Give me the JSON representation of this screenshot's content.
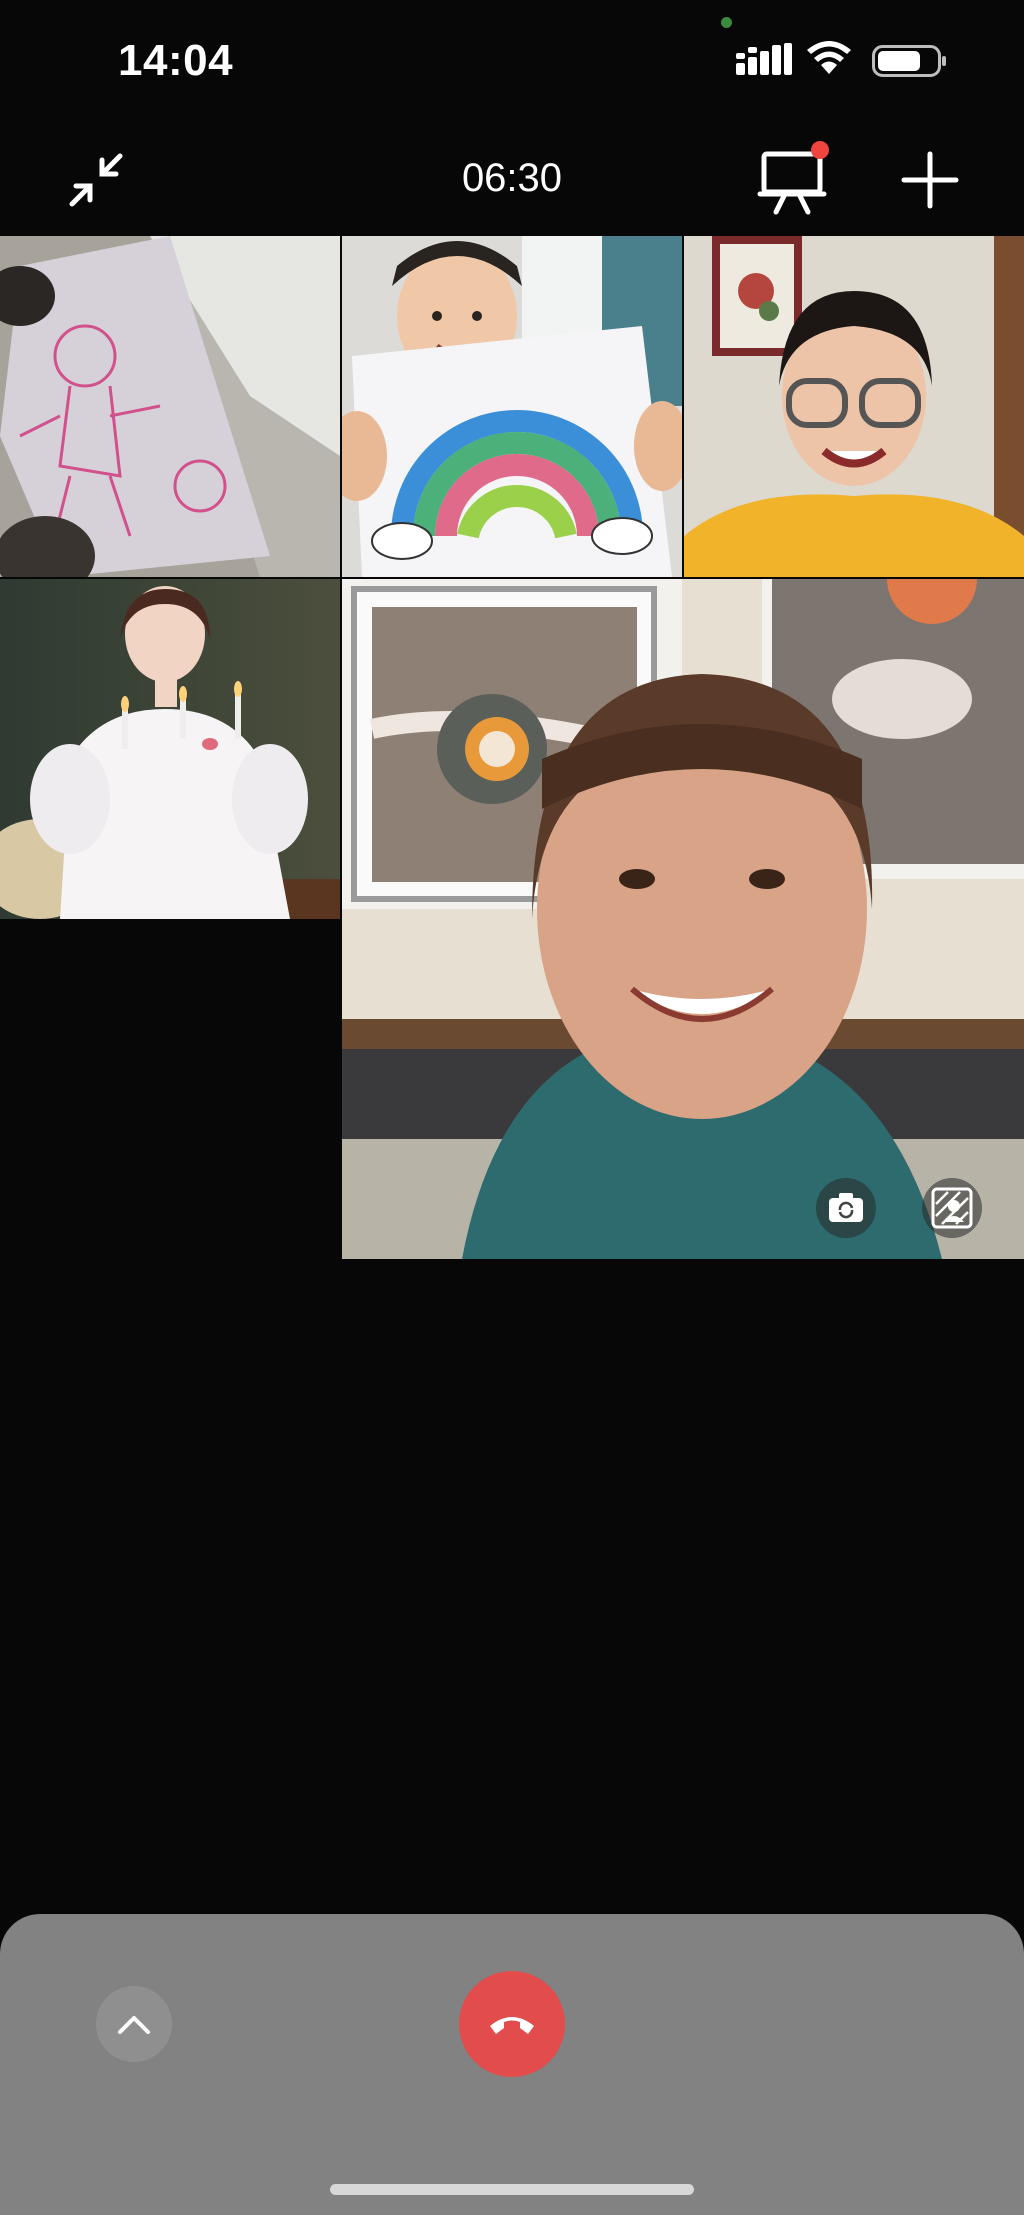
{
  "status_bar": {
    "time": "14:04",
    "icons": [
      "signal-icon",
      "wifi-icon",
      "battery-icon"
    ]
  },
  "call": {
    "duration": "06:30",
    "controls": [
      "minimize-icon",
      "screen-share-icon",
      "add-member-icon"
    ],
    "screen_share_badge_color": "#f0443e"
  },
  "tiles": [
    {
      "name": "participant-drawing-stickfigure"
    },
    {
      "name": "participant-boy-rainbow"
    },
    {
      "name": "participant-woman-glasses"
    },
    {
      "name": "participant-bride-candles"
    },
    {
      "name": "self-view-woman"
    }
  ],
  "self_view_controls": [
    "switch-camera-icon",
    "background-icon"
  ],
  "bottom_bar": {
    "controls": [
      "expand-chevron-icon",
      "hangup-icon"
    ],
    "hangup_color": "#e24c4c",
    "panel_color": "#828282"
  }
}
